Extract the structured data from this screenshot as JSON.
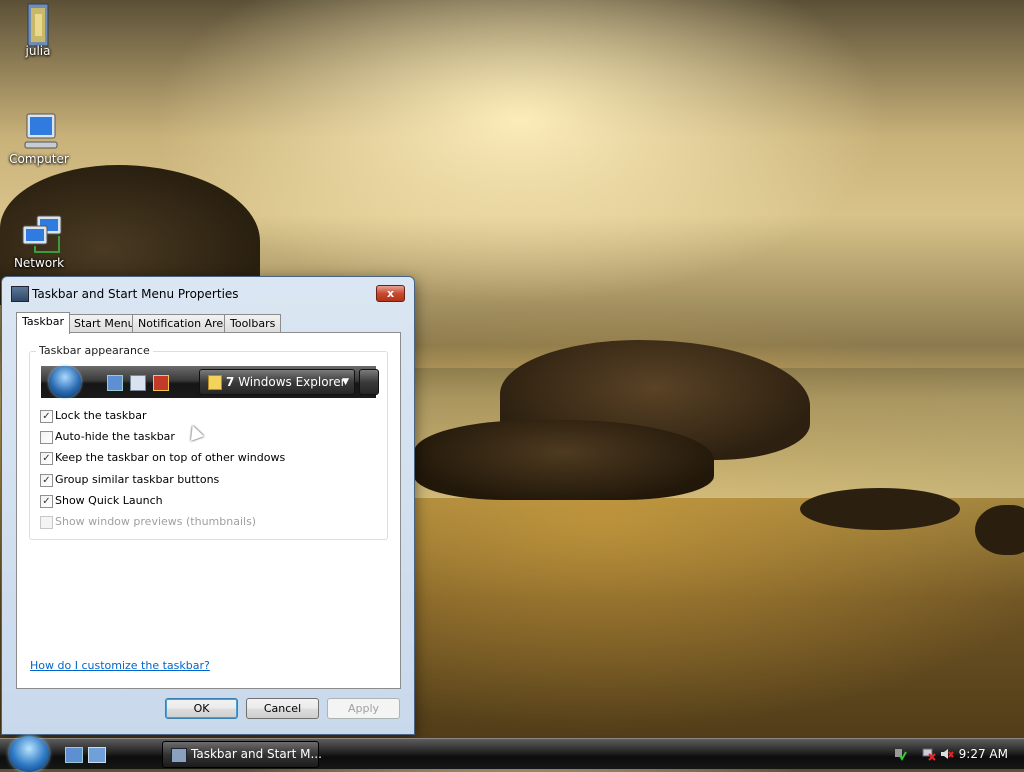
{
  "desktop": {
    "icons": [
      {
        "label": "julia",
        "icon": "folder-icon"
      },
      {
        "label": "Computer",
        "icon": "computer-icon"
      },
      {
        "label": "Network",
        "icon": "network-icon"
      }
    ]
  },
  "dialog": {
    "title": "Taskbar and Start Menu Properties",
    "close_label": "x",
    "tabs": [
      {
        "label": "Taskbar",
        "active": true
      },
      {
        "label": "Start Menu",
        "active": false
      },
      {
        "label": "Notification Area",
        "active": false
      },
      {
        "label": "Toolbars",
        "active": false
      }
    ],
    "group_label": "Taskbar appearance",
    "preview": {
      "button_count": "7",
      "button_label": "Windows Explorer"
    },
    "options": [
      {
        "label": "Lock the taskbar",
        "checked": true,
        "enabled": true
      },
      {
        "label": "Auto-hide the taskbar",
        "checked": false,
        "enabled": true
      },
      {
        "label": "Keep the taskbar on top of other windows",
        "checked": true,
        "enabled": true
      },
      {
        "label": "Group similar taskbar buttons",
        "checked": true,
        "enabled": true
      },
      {
        "label": "Show Quick Launch",
        "checked": true,
        "enabled": true
      },
      {
        "label": "Show window previews (thumbnails)",
        "checked": false,
        "enabled": false
      }
    ],
    "help_link": "How do I customize the taskbar?",
    "buttons": {
      "ok": "OK",
      "cancel": "Cancel",
      "apply": "Apply"
    }
  },
  "taskbar": {
    "task_label": "Taskbar and Start M...",
    "clock": "9:27 AM"
  },
  "colors": {
    "link": "#0066cc",
    "close_button": "#c74a32",
    "taskbar": "#161616"
  }
}
